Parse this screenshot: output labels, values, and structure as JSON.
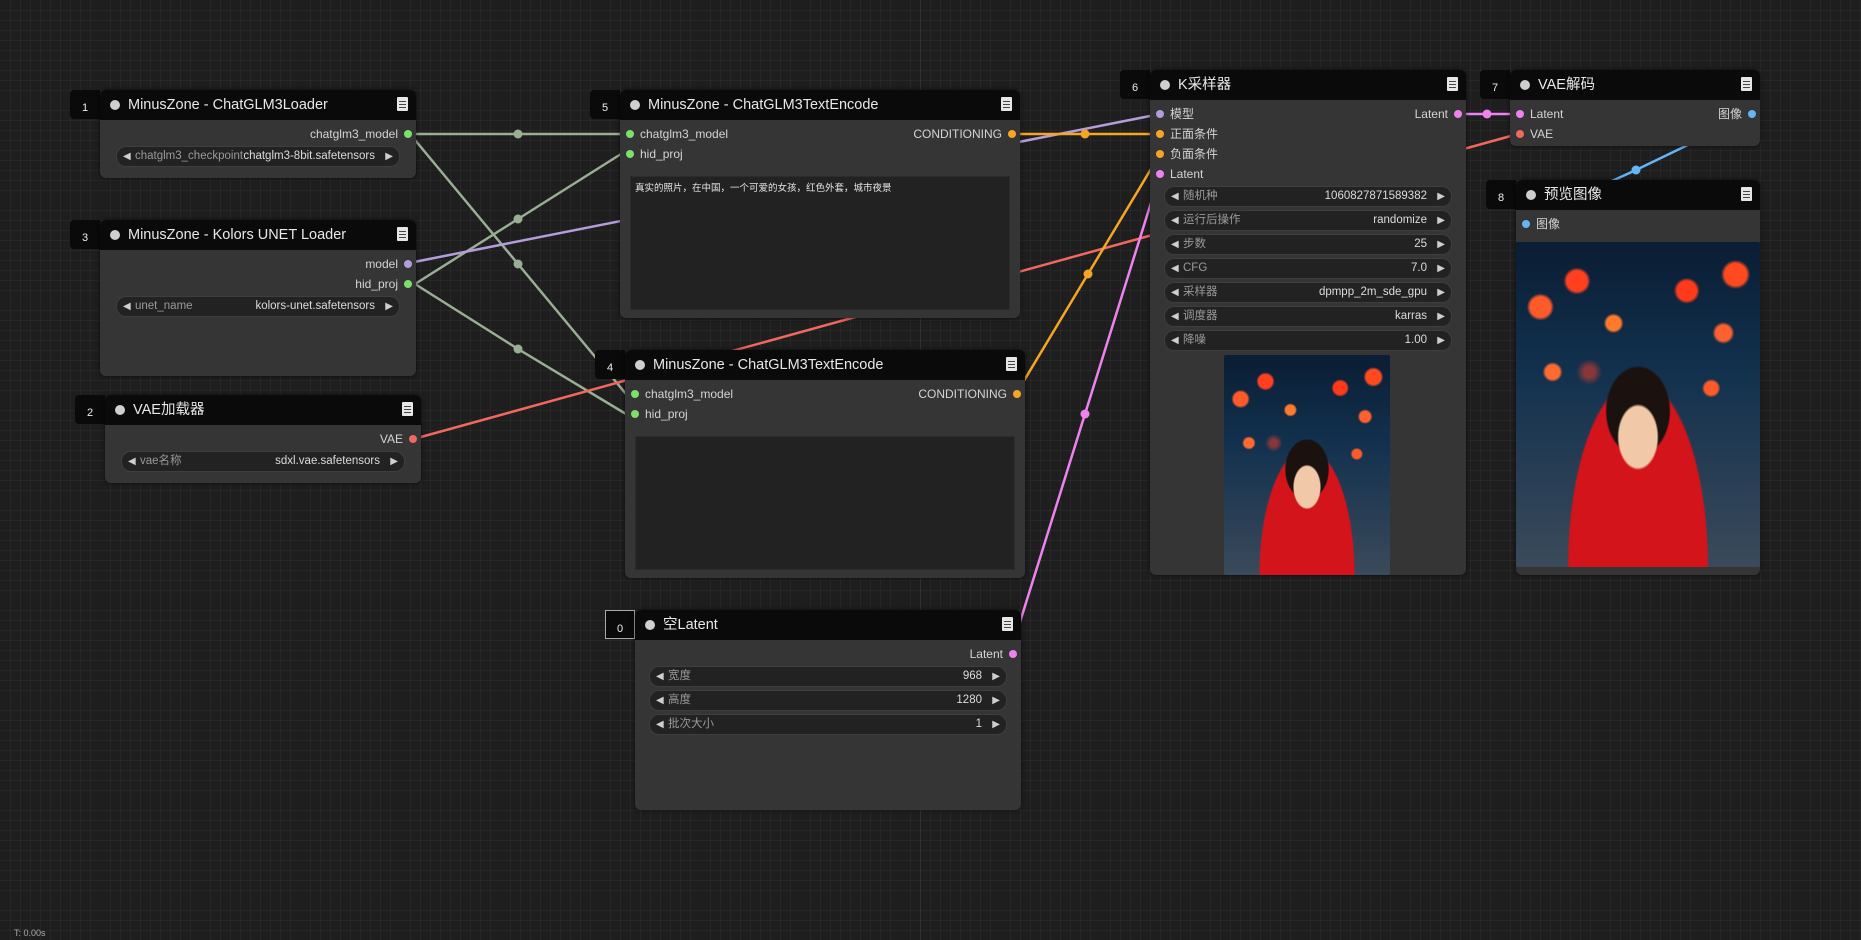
{
  "status": "T: 0.00s",
  "colors": {
    "canvas_bg": "#1e1e1e",
    "node_bg": "#353535",
    "title_bg": "#0a0a0a",
    "link_chatglm": "#9aae94",
    "link_model": "#b39ddb",
    "link_conditioning": "#f5a623",
    "link_latent": "#ee82ee",
    "link_vae": "#f0685e",
    "link_image": "#64b5f6"
  },
  "nodes": {
    "n1": {
      "id": "1",
      "title": "MinusZone - ChatGLM3Loader",
      "outputs": [
        "chatglm3_model"
      ],
      "widgets": [
        {
          "label": "chatglm3_checkpoint",
          "value": "chatglm3-8bit.safetensors"
        }
      ]
    },
    "n3": {
      "id": "3",
      "title": "MinusZone - Kolors UNET Loader",
      "outputs": [
        "model",
        "hid_proj"
      ],
      "widgets": [
        {
          "label": "unet_name",
          "value": "kolors-unet.safetensors"
        }
      ]
    },
    "n2": {
      "id": "2",
      "title": "VAE加载器",
      "outputs": [
        "VAE"
      ],
      "widgets": [
        {
          "label": "vae名称",
          "value": "sdxl.vae.safetensors"
        }
      ]
    },
    "n5": {
      "id": "5",
      "title": "MinusZone - ChatGLM3TextEncode",
      "inputs": [
        "chatglm3_model",
        "hid_proj"
      ],
      "outputs": [
        "CONDITIONING"
      ],
      "text": "真实的照片，在中国，一个可爱的女孩，红色外套，城市夜景"
    },
    "n4": {
      "id": "4",
      "title": "MinusZone - ChatGLM3TextEncode",
      "inputs": [
        "chatglm3_model",
        "hid_proj"
      ],
      "outputs": [
        "CONDITIONING"
      ],
      "text": ""
    },
    "n0": {
      "id": "0",
      "title": "空Latent",
      "outputs": [
        "Latent"
      ],
      "widgets": [
        {
          "label": "宽度",
          "value": "968"
        },
        {
          "label": "高度",
          "value": "1280"
        },
        {
          "label": "批次大小",
          "value": "1"
        }
      ]
    },
    "n6": {
      "id": "6",
      "title": "K采样器",
      "inputs": [
        "模型",
        "正面条件",
        "负面条件",
        "Latent"
      ],
      "outputs": [
        "Latent"
      ],
      "widgets": [
        {
          "label": "随机种",
          "value": "1060827871589382"
        },
        {
          "label": "运行后操作",
          "value": "randomize"
        },
        {
          "label": "步数",
          "value": "25"
        },
        {
          "label": "CFG",
          "value": "7.0"
        },
        {
          "label": "采样器",
          "value": "dpmpp_2m_sde_gpu"
        },
        {
          "label": "调度器",
          "value": "karras"
        },
        {
          "label": "降噪",
          "value": "1.00"
        }
      ]
    },
    "n7": {
      "id": "7",
      "title": "VAE解码",
      "inputs": [
        "Latent",
        "VAE"
      ],
      "outputs": [
        "图像"
      ]
    },
    "n8": {
      "id": "8",
      "title": "预览图像",
      "inputs": [
        "图像"
      ]
    }
  },
  "icons": {
    "node_menu": "document-icon",
    "collapse": "circle-dot-icon",
    "widget_dec": "triangle-left-icon",
    "widget_inc": "triangle-right-icon"
  }
}
